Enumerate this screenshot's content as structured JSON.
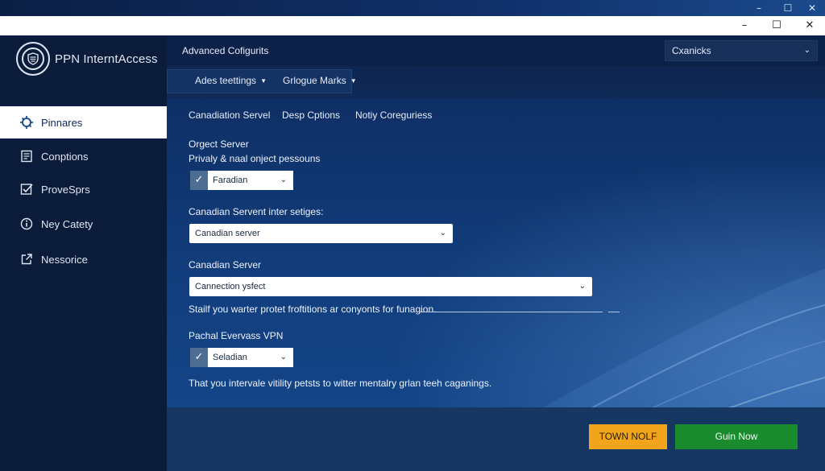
{
  "window": {
    "os_controls": [
      "–",
      "☐",
      "✕"
    ],
    "title_controls": [
      "–",
      "☐",
      "✕"
    ]
  },
  "brand": {
    "name": "PPN InterntAccess"
  },
  "sidebar": {
    "items": [
      {
        "label": "Pinnares",
        "icon": "vpn-gear-icon",
        "active": true
      },
      {
        "label": "Conptions",
        "icon": "document-icon",
        "active": false
      },
      {
        "label": "ProveSprs",
        "icon": "checkbox-icon",
        "active": false
      },
      {
        "label": "Ney Catety",
        "icon": "info-icon",
        "active": false
      },
      {
        "label": "Nessorice",
        "icon": "external-link-icon",
        "active": false
      }
    ]
  },
  "header": {
    "title": "Advanced Cofigurits",
    "select_value": "Cxanicks"
  },
  "subtabs": [
    {
      "label": "Ades teettings"
    },
    {
      "label": "Grlogue Marks"
    }
  ],
  "section_tabs": [
    {
      "label": "Canadiation Servel"
    },
    {
      "label": "Desp Cptions"
    },
    {
      "label": "Notiy Coreguriess"
    }
  ],
  "form": {
    "group1": {
      "title": "Orgect Server",
      "subtitle": "Privaly & naal onject pessouns",
      "checked": true,
      "select_value": "Faradian"
    },
    "group2": {
      "label": "Canadian Servent inter setiges:",
      "select_value": "Canadian server"
    },
    "group3": {
      "label": "Canadian Server",
      "select_value": "Cannection ysfect",
      "helper": "Stailf you warter protet froftitions ar conyonts for funagion."
    },
    "group4": {
      "label": "Pachal Evervass VPN",
      "checked": true,
      "select_value": "Seladian",
      "helper": "That you intervale vitility petsts to witter mentalry grlan teeh caganings."
    }
  },
  "buttons": {
    "secondary": "TOWN NOLF",
    "primary": "Guin Now"
  },
  "colors": {
    "accent_orange": "#f2a41b",
    "accent_green": "#1b8c2e",
    "sidebar_bg": "#0b1c3a",
    "main_bg": "#123d7c"
  }
}
